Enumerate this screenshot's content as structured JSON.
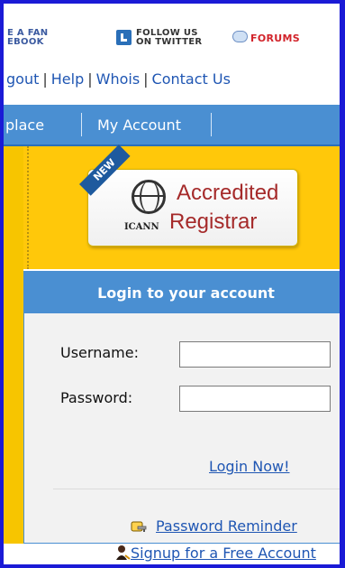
{
  "social": {
    "facebook_line1": "E A FAN",
    "facebook_line2": "EBOOK",
    "twitter_line1": "FOLLOW US",
    "twitter_line2": "ON TWITTER",
    "forums_label": "FORUMS"
  },
  "toplinks": {
    "logout": "gout",
    "help": "Help",
    "whois": "Whois",
    "contact": "Contact Us",
    "separator": "|"
  },
  "nav": {
    "marketplace": "place",
    "my_account": "My Account",
    "separator": "|"
  },
  "badge": {
    "ribbon": "NEW",
    "icann": "ICANN",
    "line1": "Accredited",
    "line2": "Registrar"
  },
  "login": {
    "title": "Login to your account",
    "username_label": "Username:",
    "password_label": "Password:",
    "username_value": "",
    "password_value": "",
    "submit": "Login Now!",
    "reminder": "Password Reminder",
    "signup": "Signup for a Free Account"
  },
  "colors": {
    "frame_border": "#1a1ad6",
    "nav_bg": "#4a8fd2",
    "yellow": "#ffc80a",
    "link": "#1f56b3",
    "accent_red": "#a52a2a"
  }
}
